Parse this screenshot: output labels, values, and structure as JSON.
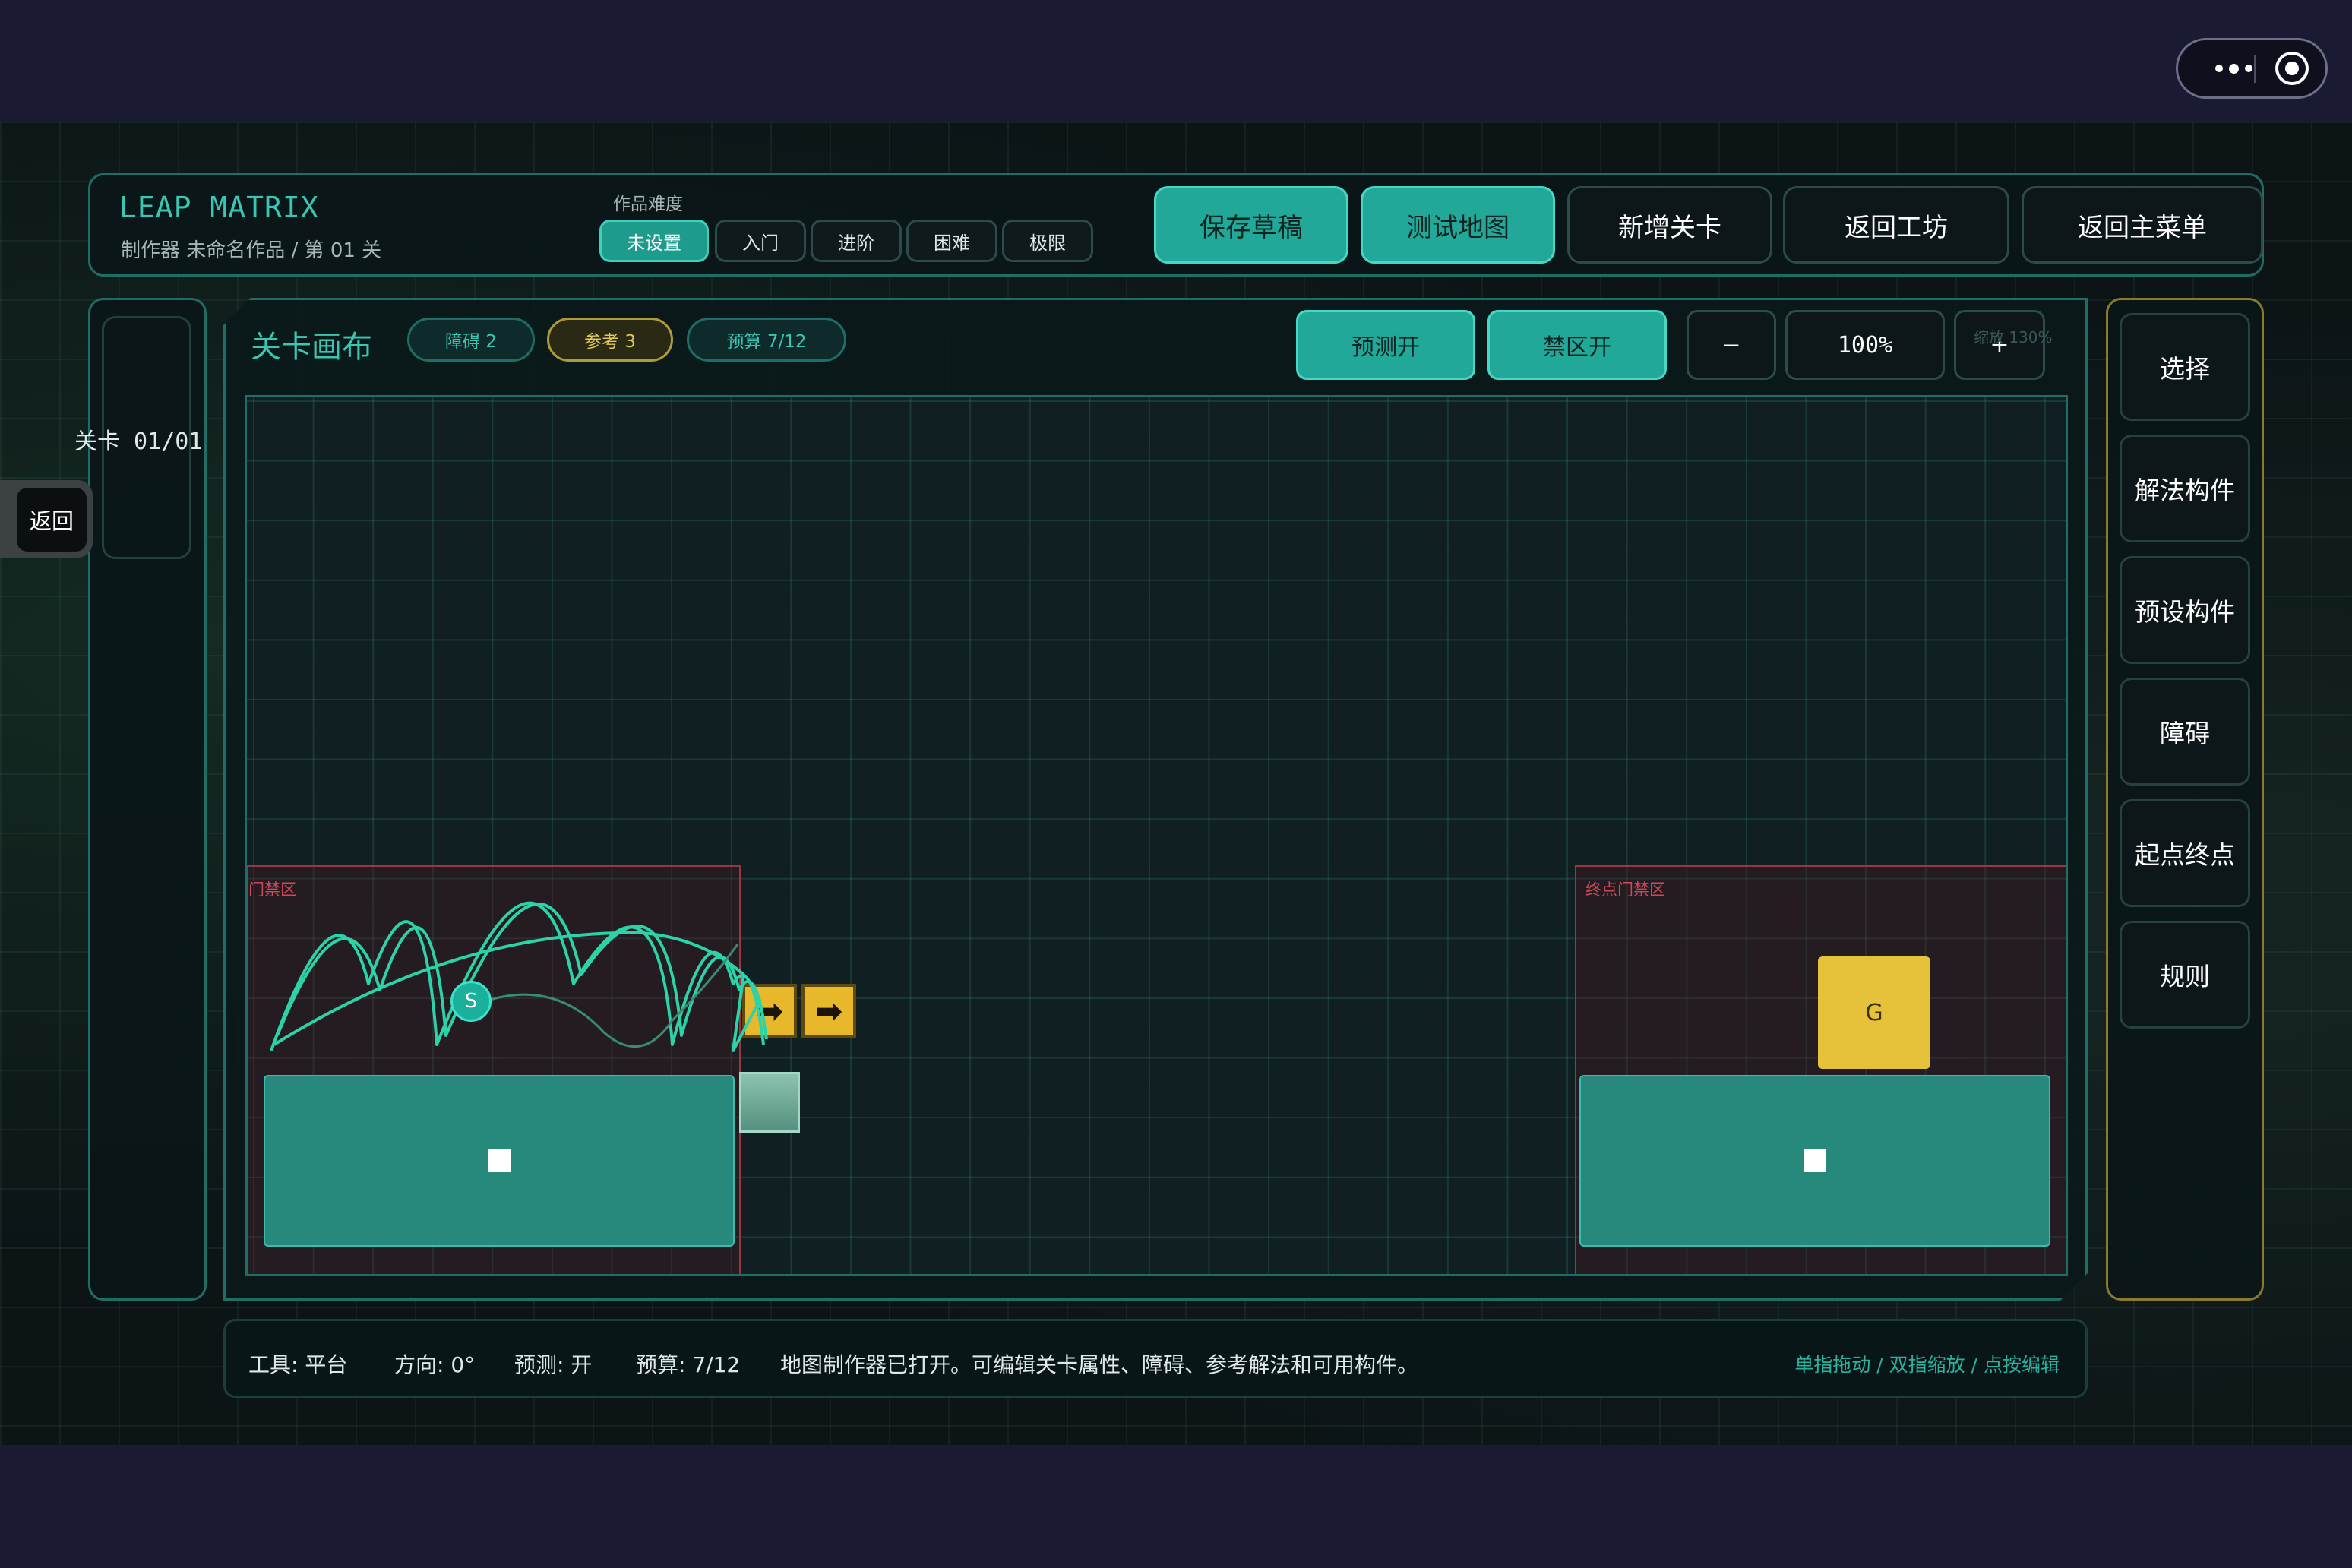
{
  "system": {
    "more_icon": "more-dots-icon",
    "capture_icon": "target-icon"
  },
  "header": {
    "logo": "LEAP MATRIX",
    "subtitle": "制作器  未命名作品 / 第 01 关",
    "difficulty_label": "作品难度",
    "difficulty_options": [
      "未设置",
      "入门",
      "进阶",
      "困难",
      "极限"
    ],
    "difficulty_selected": "未设置",
    "buttons": {
      "save_draft": "保存草稿",
      "test_map": "测试地图",
      "add_level": "新增关卡",
      "back_workshop": "返回工坊",
      "back_menu": "返回主菜单"
    }
  },
  "left": {
    "level_counter": "关卡  01/01",
    "back": "返回"
  },
  "canvas": {
    "title": "关卡画布",
    "pills": {
      "obstacles": "障碍 2",
      "references": "参考 3",
      "budget": "预算 7/12"
    },
    "predict_toggle": "预测开",
    "nozone_toggle": "禁区开",
    "zoom_out": "−",
    "zoom_value": "100%",
    "zoom_in": "+",
    "zoom_ghost": "缩放 130%",
    "zones": {
      "left": "门禁区",
      "right": "终点门禁区"
    },
    "start_label": "S",
    "goal_label": "G",
    "arrow_glyph": "➡"
  },
  "tools": [
    "选择",
    "解法构件",
    "预设构件",
    "障碍",
    "起点终点",
    "规则"
  ],
  "status": {
    "tool": "工具: 平台",
    "direction": "方向: 0°",
    "predict": "预测: 开",
    "budget": "预算: 7/12",
    "message": "地图制作器已打开。可编辑关卡属性、障碍、参考解法和可用构件。",
    "hint": "单指拖动 / 双指缩放 / 点按编辑"
  },
  "colors": {
    "accent": "#21a898",
    "gold": "#e5c23a",
    "danger": "#9a3640",
    "panel_border": "#1f6e66"
  }
}
